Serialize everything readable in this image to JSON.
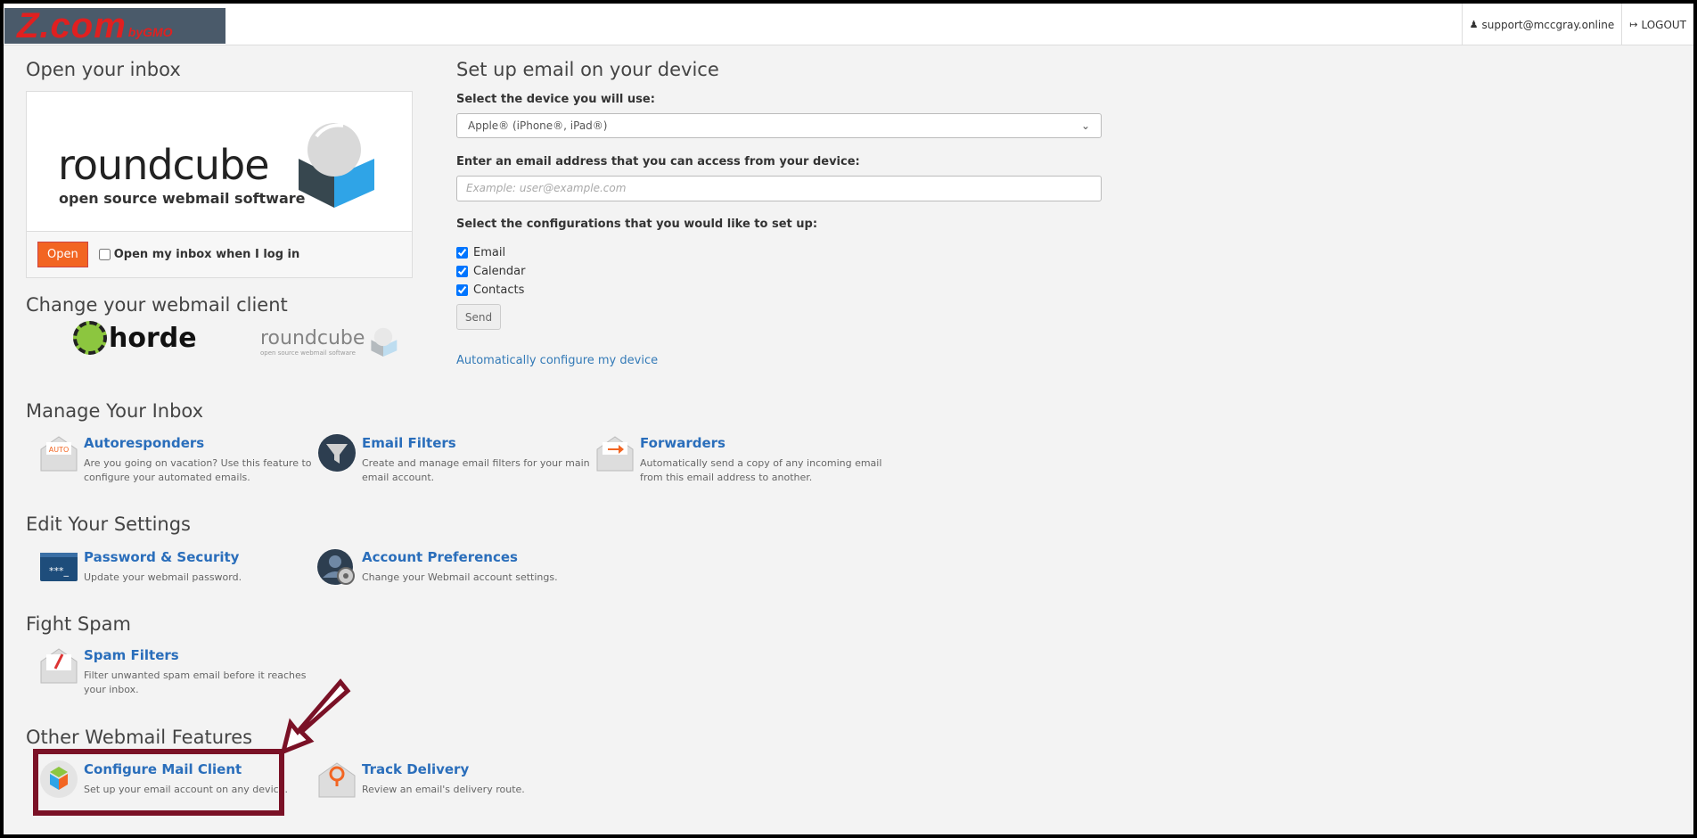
{
  "header": {
    "logo_text": "Z.com",
    "logo_sub": "byGMO",
    "user_email": "support@mccgray.online",
    "logout_label": "LOGOUT"
  },
  "inbox": {
    "title": "Open your inbox",
    "brand_name": "roundcube",
    "brand_tagline": "open source webmail software",
    "open_button": "Open",
    "open_on_login_label": "Open my inbox when I log in"
  },
  "webmail_client": {
    "title": "Change your webmail client",
    "horde_label": "horde",
    "roundcube_label": "roundcube",
    "roundcube_sub": "open source webmail software"
  },
  "device_setup": {
    "title": "Set up email on your device",
    "device_label": "Select the device you will use:",
    "device_selected": "Apple® (iPhone®, iPad®)",
    "email_label": "Enter an email address that you can access from your device:",
    "email_placeholder": "Example: user@example.com",
    "configs_label": "Select the configurations that you would like to set up:",
    "configs": [
      "Email",
      "Calendar",
      "Contacts"
    ],
    "send_button": "Send",
    "auto_configure_link": "Automatically configure my device"
  },
  "manage_inbox": {
    "title": "Manage Your Inbox",
    "items": [
      {
        "title": "Autoresponders",
        "desc1": "Are you going on vacation? Use this feature to",
        "desc2": "configure your automated emails."
      },
      {
        "title": "Email Filters",
        "desc1": "Create and manage email filters for your main",
        "desc2": "email account."
      },
      {
        "title": "Forwarders",
        "desc1": "Automatically send a copy of any incoming email",
        "desc2": "from this email address to another."
      }
    ]
  },
  "edit_settings": {
    "title": "Edit Your Settings",
    "items": [
      {
        "title": "Password & Security",
        "desc": "Update your webmail password."
      },
      {
        "title": "Account Preferences",
        "desc": "Change your Webmail account settings."
      }
    ]
  },
  "fight_spam": {
    "title": "Fight Spam",
    "items": [
      {
        "title": "Spam Filters",
        "desc1": "Filter unwanted spam email before it reaches",
        "desc2": "your inbox."
      }
    ]
  },
  "other_features": {
    "title": "Other Webmail Features",
    "items": [
      {
        "title": "Configure Mail Client",
        "desc": "Set up your email account on any device."
      },
      {
        "title": "Track Delivery",
        "desc": "Review an email's delivery route."
      }
    ]
  },
  "colors": {
    "accent_orange": "#f26522",
    "link_blue": "#2a6ebb",
    "callout_maroon": "#7a1126"
  }
}
